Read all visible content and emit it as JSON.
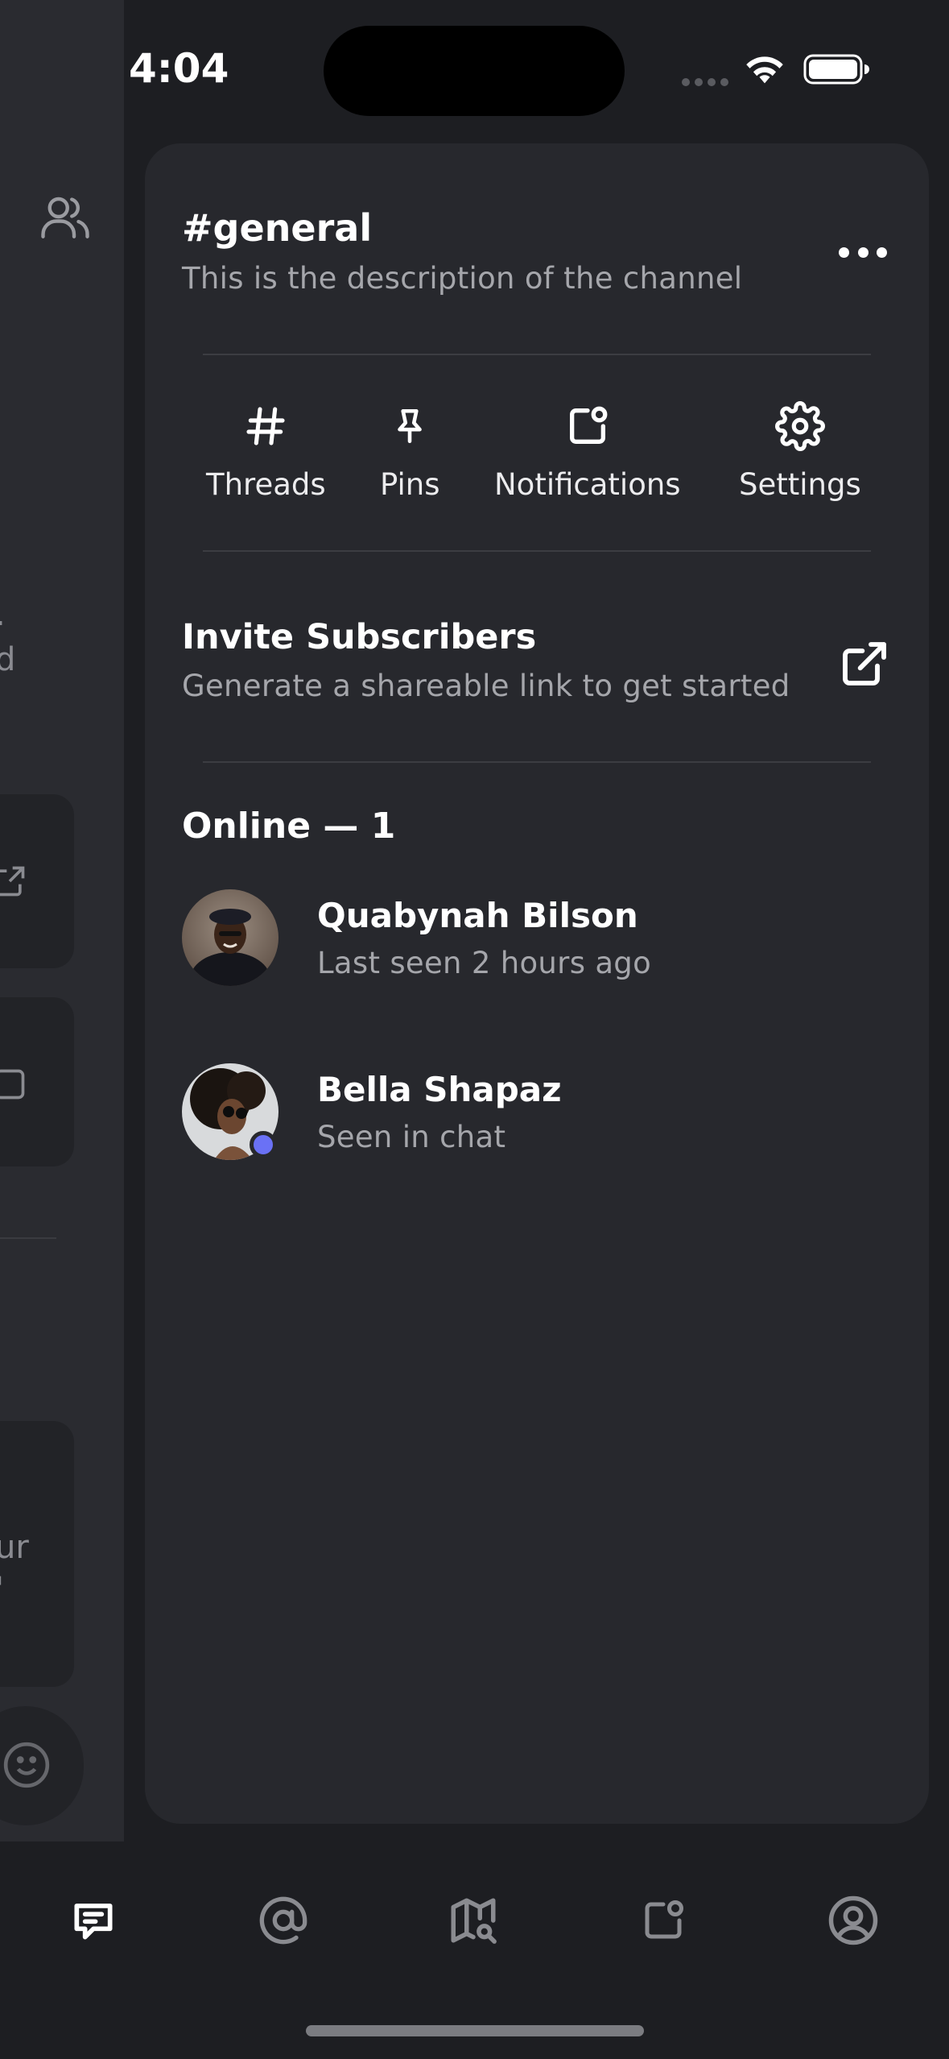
{
  "status_bar": {
    "time": "4:04"
  },
  "left_panel": {
    "fragments": [
      ".",
      "d",
      "ur",
      "'"
    ]
  },
  "channel": {
    "title": "#general",
    "description": "This is the description of the channel"
  },
  "actions": [
    {
      "label": "Threads",
      "icon": "hash-icon"
    },
    {
      "label": "Pins",
      "icon": "pin-icon"
    },
    {
      "label": "Notifications",
      "icon": "notification-icon"
    },
    {
      "label": "Settings",
      "icon": "gear-icon"
    }
  ],
  "invite": {
    "title": "Invite Subscribers",
    "subtitle": "Generate a shareable link to get started"
  },
  "online": {
    "heading": "Online — 1",
    "members": [
      {
        "name": "Quabynah Bilson",
        "status": "Last seen 2 hours ago",
        "online": false
      },
      {
        "name": "Bella Shapaz",
        "status": "Seen in chat",
        "online": true
      }
    ]
  },
  "tabbar": {
    "tabs": [
      {
        "icon": "chat-icon",
        "active": true
      },
      {
        "icon": "mention-icon",
        "active": false
      },
      {
        "icon": "map-search-icon",
        "active": false
      },
      {
        "icon": "notification-icon",
        "active": false
      },
      {
        "icon": "profile-icon",
        "active": false
      }
    ]
  },
  "colors": {
    "background": "#1d1e22",
    "panel": "#27282d",
    "accent": "#6a71f5",
    "text_secondary": "#a5a6ab"
  }
}
